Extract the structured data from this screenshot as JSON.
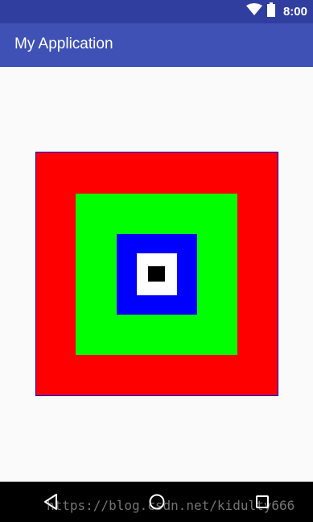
{
  "status_bar": {
    "time": "8:00",
    "icons": [
      "wifi-icon",
      "battery-icon"
    ]
  },
  "app_bar": {
    "title": "My Application"
  },
  "canvas": {
    "squares": [
      {
        "name": "red-square",
        "color": "#ff0000",
        "border": "#0000ff"
      },
      {
        "name": "green-square",
        "color": "#00ff00"
      },
      {
        "name": "blue-square",
        "color": "#0000ff"
      },
      {
        "name": "white-square",
        "color": "#ffffff"
      },
      {
        "name": "black-square",
        "color": "#000000"
      }
    ]
  },
  "nav_bar": {
    "buttons": [
      "back-icon",
      "home-icon",
      "recents-icon"
    ]
  },
  "watermark": "https://blog.csdn.net/kidulty666",
  "colors": {
    "status_bar": "#303f9f",
    "app_bar": "#3f51b5",
    "background": "#fafafa",
    "nav_bar": "#000000"
  }
}
